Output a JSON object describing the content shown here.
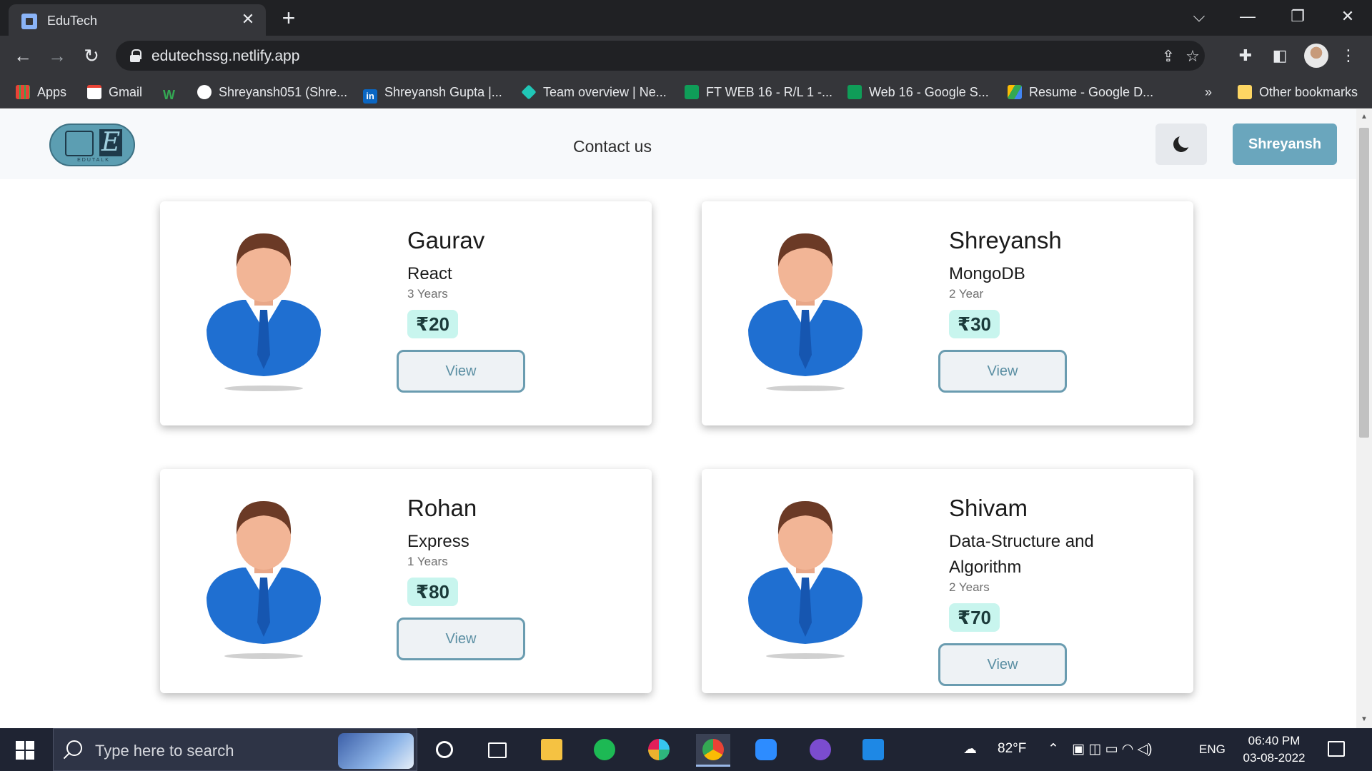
{
  "browser": {
    "tab_title": "EduTech",
    "tab_close": "✕",
    "new_tab": "+",
    "url": "edutechssg.netlify.app",
    "window_controls": {
      "dropdown": "⌵",
      "minimize": "—",
      "restore": "❐",
      "close": "✕"
    },
    "nav": {
      "back": "←",
      "forward": "→",
      "reload": "↻"
    },
    "bookmarks": [
      {
        "label": "Apps",
        "icon": "apps-grid-icon"
      },
      {
        "label": "Gmail",
        "icon": "gmail-icon"
      },
      {
        "label": "",
        "icon": "w-icon"
      },
      {
        "label": "Shreyansh051 (Shre...",
        "icon": "github-icon"
      },
      {
        "label": "Shreyansh Gupta |...",
        "icon": "linkedin-icon"
      },
      {
        "label": "Team overview | Ne...",
        "icon": "diamond-icon"
      },
      {
        "label": "FT WEB 16 - R/L 1 -...",
        "icon": "sheets-icon"
      },
      {
        "label": "Web 16 - Google S...",
        "icon": "sheets-icon"
      },
      {
        "label": "Resume - Google D...",
        "icon": "drive-icon"
      }
    ],
    "bookmarks_overflow": "»",
    "other_bookmarks": "Other bookmarks"
  },
  "site": {
    "logo_text": "EDUTALK",
    "logo_letter": "E",
    "nav_link": "Contact us",
    "user_button": "Shreyansh"
  },
  "tutors": [
    {
      "name": "Gaurav",
      "subject": "React",
      "experience": "3 Years",
      "price": "₹20",
      "action": "View"
    },
    {
      "name": "Shreyansh",
      "subject": "MongoDB",
      "experience": "2 Year",
      "price": "₹30",
      "action": "View"
    },
    {
      "name": "Rohan",
      "subject": "Express",
      "experience": "1 Years",
      "price": "₹80",
      "action": "View"
    },
    {
      "name": "Shivam",
      "subject": "Data-Structure and Algorithm",
      "experience": "2 Years",
      "price": "₹70",
      "action": "View"
    }
  ],
  "taskbar": {
    "search_placeholder": "Type here to search",
    "weather": "82°F",
    "language": "ENG",
    "time": "06:40 PM",
    "date": "03-08-2022"
  }
}
